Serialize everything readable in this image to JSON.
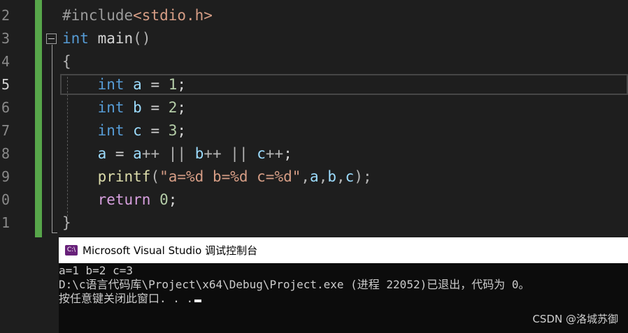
{
  "editor": {
    "line_numbers": [
      "2",
      "3",
      "4",
      "5",
      "6",
      "7",
      "8",
      "9",
      "0",
      "1"
    ],
    "active_line": "5",
    "lines": {
      "l1": {
        "preproc": "#include",
        "header": "<stdio.h>"
      },
      "l2": {
        "type": "int",
        "name": "main",
        "parens": "()"
      },
      "l3": {
        "brace": "{"
      },
      "l4": {
        "type": "int",
        "var": "a",
        "op": " = ",
        "num": "1",
        "semi": ";"
      },
      "l5": {
        "type": "int",
        "var": "b",
        "op": " = ",
        "num": "2",
        "semi": ";"
      },
      "l6": {
        "type": "int",
        "var": "c",
        "op": " = ",
        "num": "3",
        "semi": ";"
      },
      "l7": {
        "a1": "a",
        "eq": " = ",
        "a2": "a",
        "inc1": "++",
        "or1": " || ",
        "b": "b",
        "inc2": "++",
        "or2": " || ",
        "c": "c",
        "inc3": "++",
        "semi": ";"
      },
      "l8": {
        "fn": "printf",
        "open": "(",
        "fmt": "\"a=%d b=%d c=%d\"",
        "c1": ",",
        "a": "a",
        "c2": ",",
        "b": "b",
        "c3": ",",
        "c": "c",
        "close": ")",
        "semi": ";"
      },
      "l9": {
        "kw": "return",
        "num": "0",
        "semi": ";"
      },
      "l10": {
        "brace": "}"
      }
    }
  },
  "console": {
    "title": "Microsoft Visual Studio 调试控制台",
    "icon": "visual-studio-icon",
    "output": [
      "a=1 b=2 c=3",
      "D:\\c语言代码库\\Project\\x64\\Debug\\Project.exe (进程 22052)已退出，代码为 0。",
      "按任意键关闭此窗口. . ."
    ]
  },
  "watermark": "CSDN @洛城苏御",
  "colors": {
    "keyword": "#569cd6",
    "string": "#d69d85",
    "number": "#b5cea8",
    "variable": "#9cdcfe",
    "change_bar": "#57a64a"
  }
}
